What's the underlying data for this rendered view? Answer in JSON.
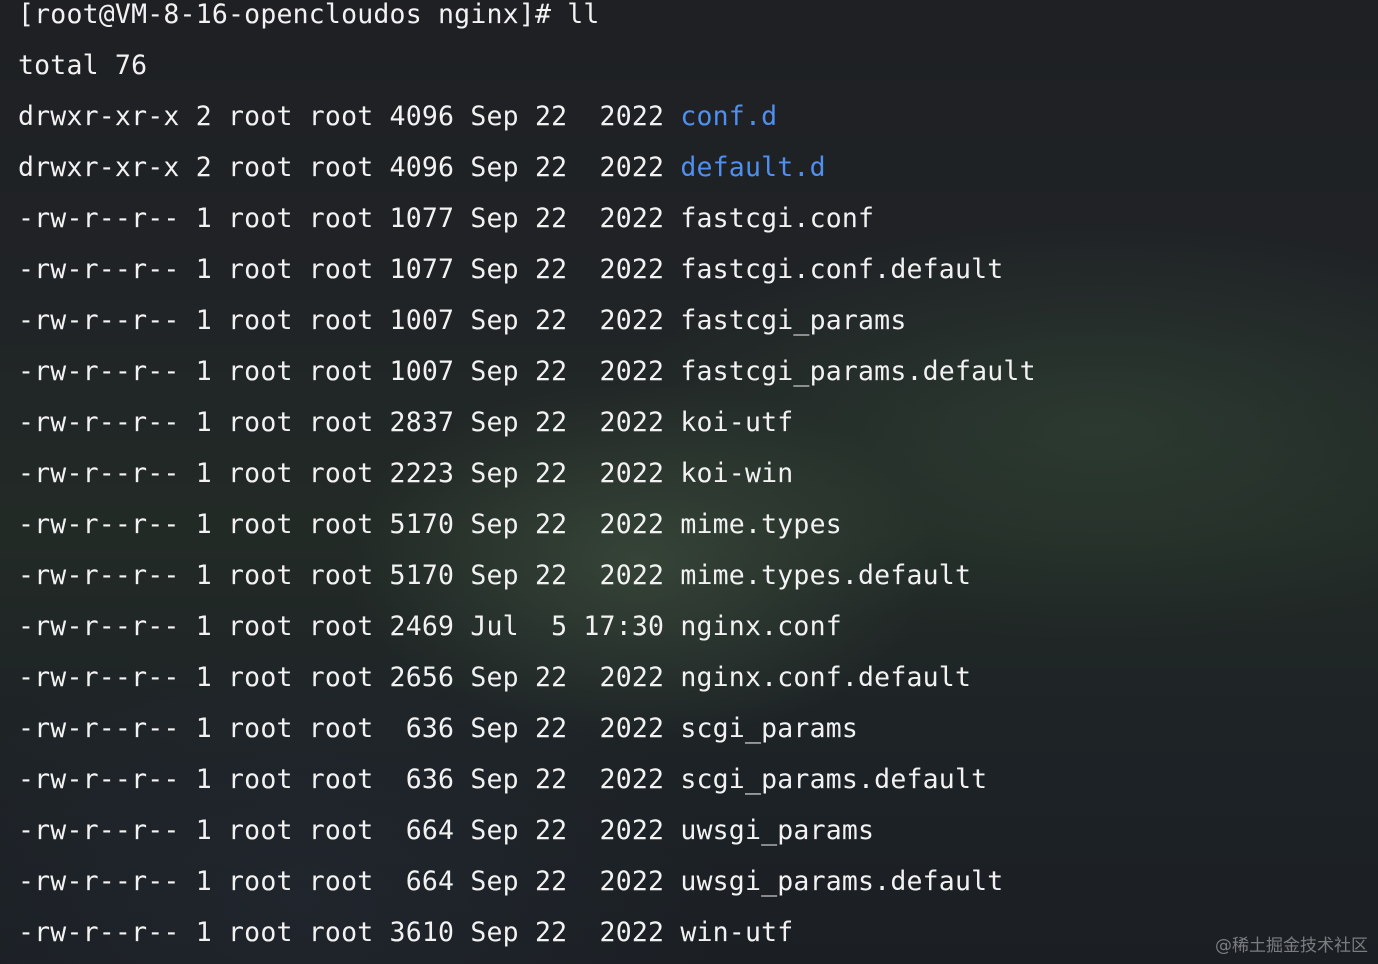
{
  "terminal": {
    "prompt": "[root@VM-8-16-opencloudos nginx]# ll",
    "total": "total 76",
    "entries": [
      {
        "meta": "drwxr-xr-x 2 root root 4096 Sep 22  2022 ",
        "name": "conf.d",
        "type": "dir"
      },
      {
        "meta": "drwxr-xr-x 2 root root 4096 Sep 22  2022 ",
        "name": "default.d",
        "type": "dir"
      },
      {
        "meta": "-rw-r--r-- 1 root root 1077 Sep 22  2022 ",
        "name": "fastcgi.conf",
        "type": "file"
      },
      {
        "meta": "-rw-r--r-- 1 root root 1077 Sep 22  2022 ",
        "name": "fastcgi.conf.default",
        "type": "file"
      },
      {
        "meta": "-rw-r--r-- 1 root root 1007 Sep 22  2022 ",
        "name": "fastcgi_params",
        "type": "file"
      },
      {
        "meta": "-rw-r--r-- 1 root root 1007 Sep 22  2022 ",
        "name": "fastcgi_params.default",
        "type": "file"
      },
      {
        "meta": "-rw-r--r-- 1 root root 2837 Sep 22  2022 ",
        "name": "koi-utf",
        "type": "file"
      },
      {
        "meta": "-rw-r--r-- 1 root root 2223 Sep 22  2022 ",
        "name": "koi-win",
        "type": "file"
      },
      {
        "meta": "-rw-r--r-- 1 root root 5170 Sep 22  2022 ",
        "name": "mime.types",
        "type": "file"
      },
      {
        "meta": "-rw-r--r-- 1 root root 5170 Sep 22  2022 ",
        "name": "mime.types.default",
        "type": "file"
      },
      {
        "meta": "-rw-r--r-- 1 root root 2469 Jul  5 17:30 ",
        "name": "nginx.conf",
        "type": "file"
      },
      {
        "meta": "-rw-r--r-- 1 root root 2656 Sep 22  2022 ",
        "name": "nginx.conf.default",
        "type": "file"
      },
      {
        "meta": "-rw-r--r-- 1 root root  636 Sep 22  2022 ",
        "name": "scgi_params",
        "type": "file"
      },
      {
        "meta": "-rw-r--r-- 1 root root  636 Sep 22  2022 ",
        "name": "scgi_params.default",
        "type": "file"
      },
      {
        "meta": "-rw-r--r-- 1 root root  664 Sep 22  2022 ",
        "name": "uwsgi_params",
        "type": "file"
      },
      {
        "meta": "-rw-r--r-- 1 root root  664 Sep 22  2022 ",
        "name": "uwsgi_params.default",
        "type": "file"
      },
      {
        "meta": "-rw-r--r-- 1 root root 3610 Sep 22  2022 ",
        "name": "win-utf",
        "type": "file"
      }
    ]
  },
  "watermark": "@稀土掘金技术社区",
  "colors": {
    "text": "#f2f2f2",
    "directory": "#4f8ff0",
    "background": "#1f2226"
  }
}
